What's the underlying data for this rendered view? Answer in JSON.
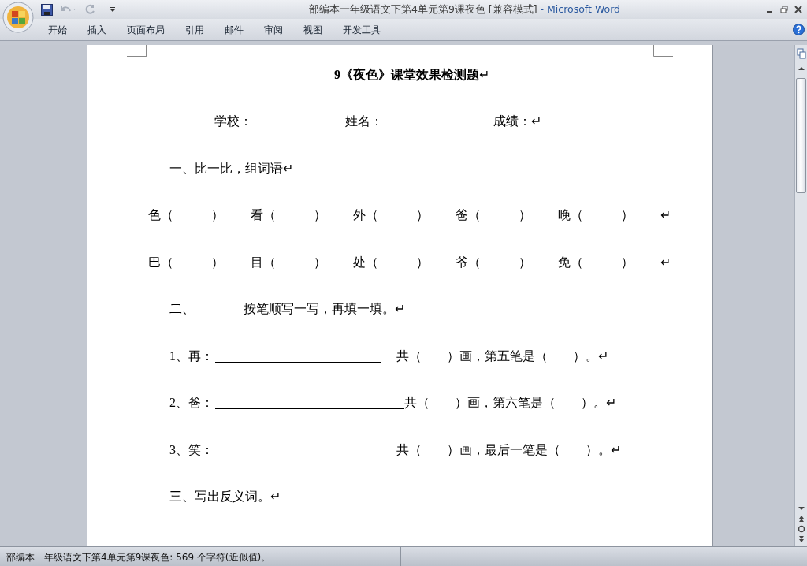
{
  "window": {
    "title": "部编本一年级语文下第4单元第9课夜色 [兼容模式]",
    "app_name": "- Microsoft Word"
  },
  "ribbon_tabs": [
    "开始",
    "插入",
    "页面布局",
    "引用",
    "邮件",
    "审阅",
    "视图",
    "开发工具"
  ],
  "document": [
    {
      "kind": "title",
      "text": "9《夜色》课堂效果检测题",
      "end_mark": "↵"
    },
    {
      "kind": "fields",
      "items": [
        "学校：",
        "姓名：",
        "成绩："
      ],
      "end_mark": "↵"
    },
    {
      "kind": "text",
      "text": "一、比一比，组词语",
      "end_mark": "↵"
    },
    {
      "kind": "pairs",
      "items": [
        "色（　　　）",
        "看（　　　）",
        "外（　　　）",
        "爸（　　　）",
        "晚（　　　）"
      ],
      "end_mark": "↵"
    },
    {
      "kind": "pairs",
      "items": [
        "巴（　　　）",
        "目（　　　）",
        "处（　　　）",
        "爷（　　　）",
        "免（　　　）"
      ],
      "end_mark": "↵"
    },
    {
      "kind": "numbered",
      "number": "二、",
      "text": "按笔顺写一写，再填一填。",
      "end_mark": "↵"
    },
    {
      "kind": "stroke",
      "label": "1、再：",
      "rest": "共（　　）画，第五笔是（　　）。",
      "end_mark": "↵"
    },
    {
      "kind": "stroke",
      "label": "2、爸：",
      "rest": "共（　　）画，第六笔是（　　）。",
      "end_mark": "↵"
    },
    {
      "kind": "stroke",
      "label": "3、笑：",
      "rest": "共（　　）画，最后一笔是（　　）。",
      "end_mark": "↵"
    },
    {
      "kind": "text",
      "text": "三、写出反义词。",
      "end_mark": "↵"
    }
  ],
  "status_bar": {
    "text": "部编本一年级语文下第4单元第9课夜色: 569 个字符(近似值)。"
  }
}
